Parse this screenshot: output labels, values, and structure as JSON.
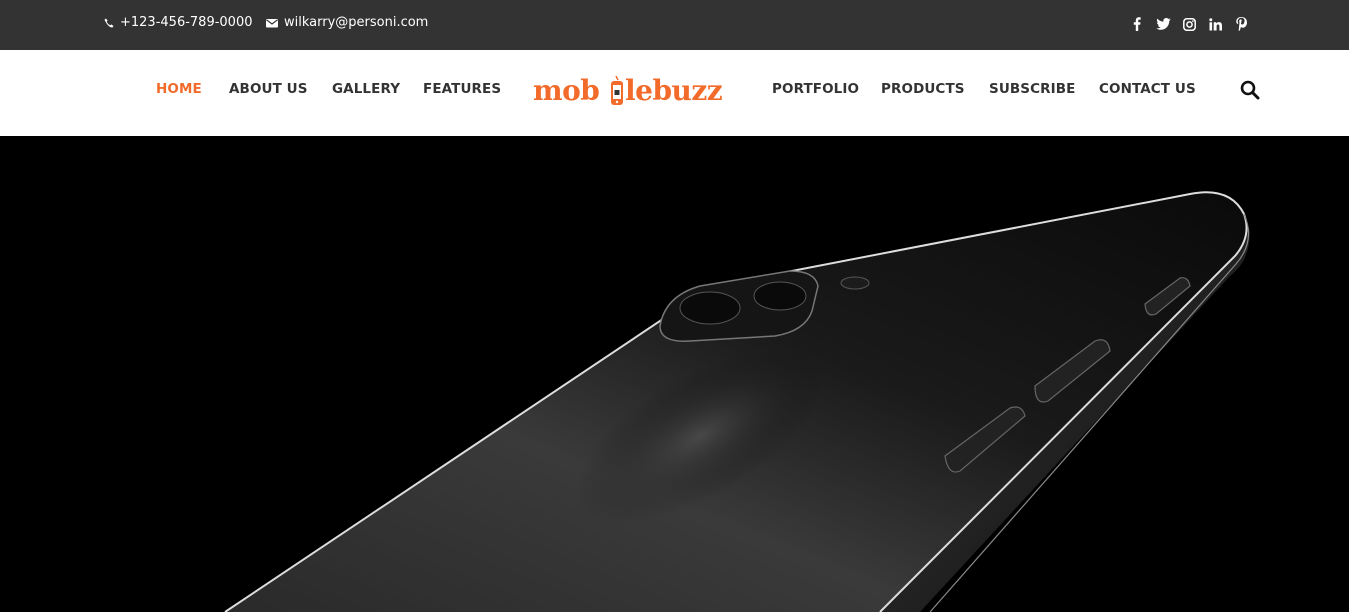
{
  "topbar": {
    "phone": "+123-456-789-0000",
    "email": "wilkarry@personi.com",
    "social_icons": [
      "facebook-icon",
      "twitter-icon",
      "instagram-icon",
      "linkedin-icon",
      "pinterest-icon"
    ]
  },
  "nav": {
    "left_items": [
      "HOME",
      "ABOUT US",
      "GALLERY",
      "FEATURES"
    ],
    "right_items": [
      "PORTFOLIO",
      "PRODUCTS",
      "SUBSCRIBE",
      "CONTACT US"
    ],
    "active": "HOME"
  },
  "logo": {
    "text_left": "mob",
    "text_right": "lebuzz"
  },
  "colors": {
    "accent": "#f26b2b",
    "topbar_bg": "#333333",
    "nav_text": "#333333",
    "hero_bg": "#000000"
  },
  "search": {
    "icon": "search-icon"
  },
  "hero": {
    "image": "phone-product-image"
  }
}
